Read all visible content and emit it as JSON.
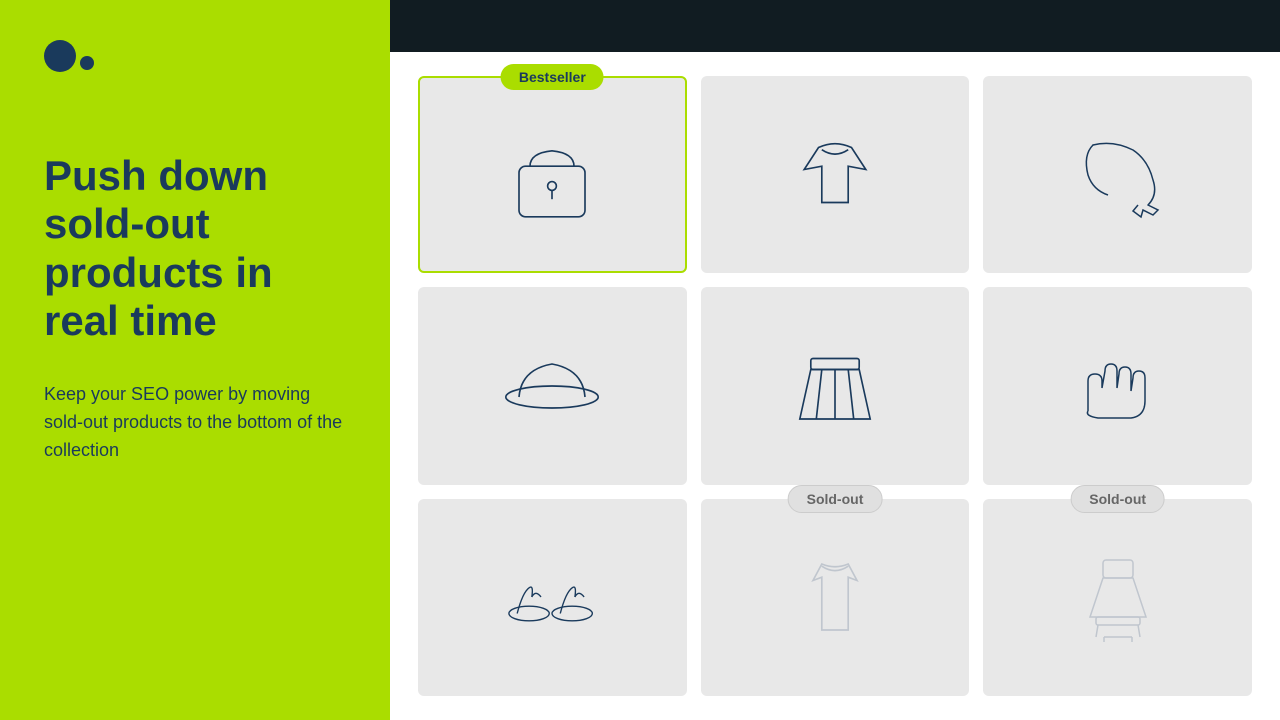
{
  "left": {
    "headline": "Push down sold-out products in real time",
    "description": "Keep your SEO power by moving sold-out products to the bottom of the collection"
  },
  "right": {
    "products": [
      {
        "id": 1,
        "type": "bag",
        "badge": "Bestseller",
        "badgeType": "bestseller",
        "highlighted": true,
        "faded": false
      },
      {
        "id": 2,
        "type": "top",
        "badge": null,
        "badgeType": null,
        "highlighted": false,
        "faded": false
      },
      {
        "id": 3,
        "type": "scarf",
        "badge": null,
        "badgeType": null,
        "highlighted": false,
        "faded": false
      },
      {
        "id": 4,
        "type": "hat",
        "badge": null,
        "badgeType": null,
        "highlighted": false,
        "faded": false
      },
      {
        "id": 5,
        "type": "skirt",
        "badge": null,
        "badgeType": null,
        "highlighted": false,
        "faded": false
      },
      {
        "id": 6,
        "type": "gloves",
        "badge": null,
        "badgeType": null,
        "highlighted": false,
        "faded": false
      },
      {
        "id": 7,
        "type": "sandals",
        "badge": null,
        "badgeType": null,
        "highlighted": false,
        "faded": false
      },
      {
        "id": 8,
        "type": "tank",
        "badge": "Sold-out",
        "badgeType": "soldout",
        "highlighted": false,
        "faded": true
      },
      {
        "id": 9,
        "type": "dress",
        "badge": "Sold-out",
        "badgeType": "soldout",
        "highlighted": false,
        "faded": true
      }
    ]
  }
}
